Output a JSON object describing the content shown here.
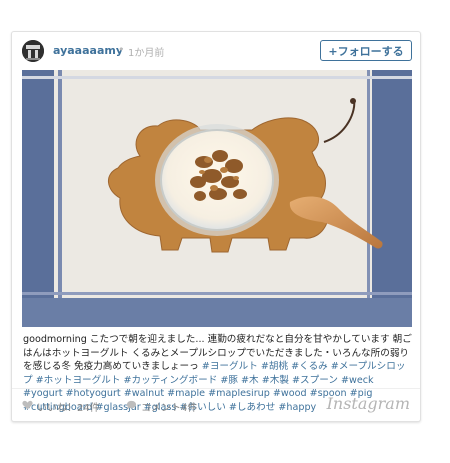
{
  "post": {
    "username": "ayaaaaamy",
    "separator": "•",
    "time": "1か月前",
    "follow_label": "+フォローする"
  },
  "caption": {
    "text": "goodmorning こたつで朝を迎えました... 連勤の疲れだなと自分を甘やかしています 朝ごはんはホットヨーグルト くるみとメープルシロップでいただきました・いろんな所の弱りを感じる冬 免疫力高めていきましょーっ ",
    "tags": "#ヨーグルト #胡桃 #くるみ #メープルシロップ #ホットヨーグルト #カッティングボード #豚 #木 #木製 #スプーン #weck #yogurt #hotyogurt #walnut #maple #maplesirup #wood #spoon #pig #cuttingboard #glassjar #glass #おいしい #しあわせ #happy"
  },
  "footer": {
    "likes": "いいね！24件",
    "comments": "コメント4件",
    "brand": "Instagram"
  },
  "icons": [
    "heart-icon",
    "comment-icon"
  ],
  "colors": {
    "link": "#3f729b",
    "muted": "#888888"
  }
}
